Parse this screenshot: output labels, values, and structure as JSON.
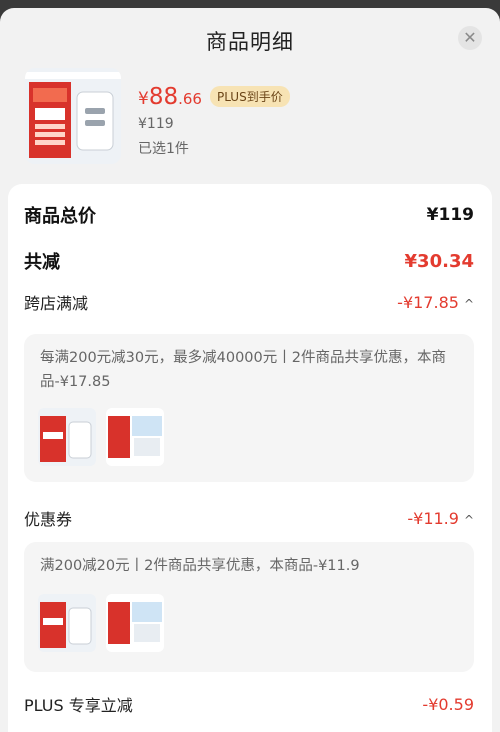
{
  "header": {
    "title": "商品明细",
    "close_icon": "close-icon"
  },
  "product": {
    "image": "product-image",
    "currency": "¥",
    "price_int": "88",
    "price_dec": ".66",
    "plus_tag": "PLUS到手价",
    "original_price": "¥119",
    "selected": "已选1件"
  },
  "summary": {
    "total_label": "商品总价",
    "total_value": "¥119",
    "discount_label": "共减",
    "discount_value": "¥30.34"
  },
  "sections": {
    "store": {
      "label": "跨店满减",
      "value": "-¥17.85",
      "desc": "每满200元减30元，最多减40000元丨2件商品共享优惠，本商品-¥17.85"
    },
    "coupon": {
      "label": "优惠券",
      "value": "-¥11.9",
      "desc": "满200减20元丨2件商品共享优惠，本商品-¥11.9"
    },
    "plus": {
      "label": "PLUS 专享立减",
      "value": "-¥0.59"
    }
  },
  "colors": {
    "accent": "#e33b2f",
    "plus_tag_bg": "#f7e3b4"
  }
}
